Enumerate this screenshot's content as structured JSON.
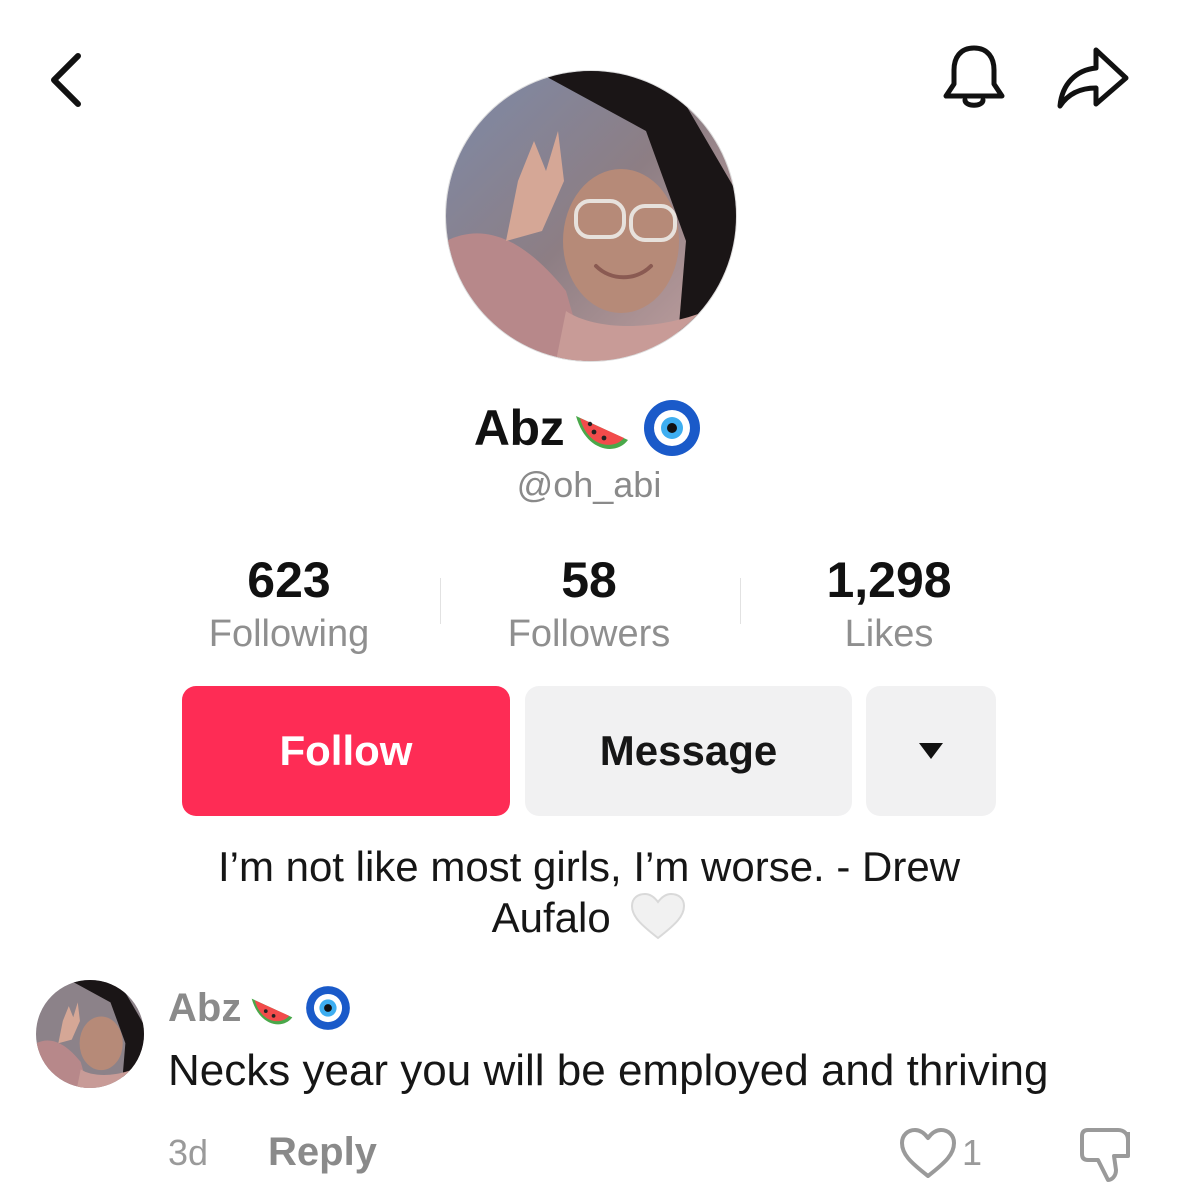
{
  "nav": {
    "back_icon": "chevron-left-icon",
    "bell_icon": "bell-icon",
    "share_icon": "share-arrow-icon"
  },
  "profile": {
    "display_name": "Abz",
    "name_emojis": [
      "watermelon-emoji",
      "nazar-amulet-emoji"
    ],
    "handle": "@oh_abi",
    "stats": [
      {
        "value": "623",
        "label": "Following"
      },
      {
        "value": "58",
        "label": "Followers"
      },
      {
        "value": "1,298",
        "label": "Likes"
      }
    ],
    "follow_label": "Follow",
    "message_label": "Message",
    "more_icon": "caret-down-icon",
    "bio_line1": "I’m not like most girls, I’m worse. - Drew",
    "bio_line2": "Aufalo",
    "bio_emoji": "white-heart-emoji"
  },
  "comment": {
    "author": "Abz",
    "text": "Necks year you will be employed and thriving",
    "time": "3d",
    "reply_label": "Reply",
    "like_count": "1"
  },
  "colors": {
    "accent": "#fe2c55",
    "secondary_button": "#f1f1f2",
    "muted_text": "#8a8a8a"
  }
}
